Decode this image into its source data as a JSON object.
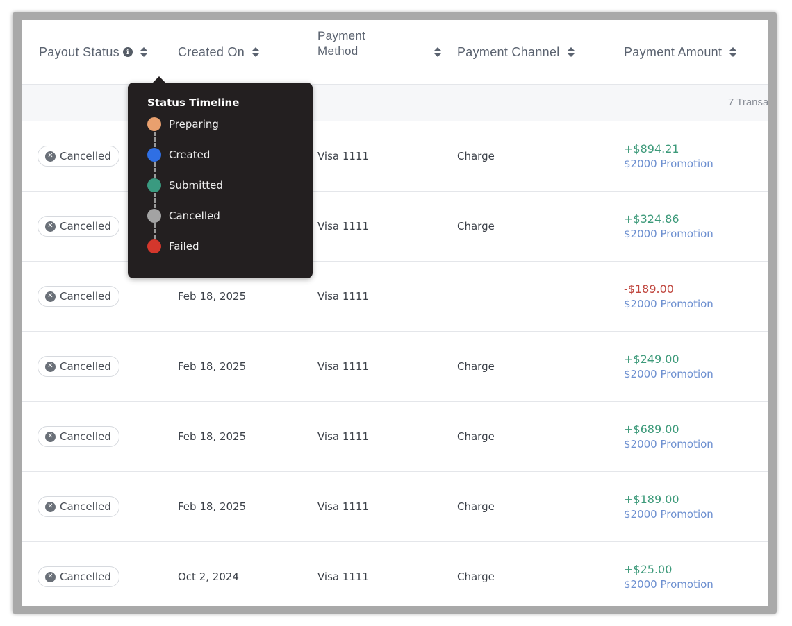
{
  "header": {
    "payout_status": "Payout Status",
    "created_on": "Created On",
    "payment_method_line1": "Payment",
    "payment_method_line2": "Method",
    "payment_channel": "Payment Channel",
    "payment_amount": "Payment Amount"
  },
  "group": {
    "count_text": "7 Transa"
  },
  "rows": [
    {
      "status": "Cancelled",
      "created": "",
      "method": "Visa 1111",
      "channel": "Charge",
      "amount": "+$894.21",
      "promo": "$2000 Promotion"
    },
    {
      "status": "Cancelled",
      "created": "",
      "method": "Visa 1111",
      "channel": "Charge",
      "amount": "+$324.86",
      "promo": "$2000 Promotion"
    },
    {
      "status": "Cancelled",
      "created": "Feb 18, 2025",
      "method": "Visa 1111",
      "channel": "",
      "amount": "-$189.00",
      "promo": "$2000 Promotion"
    },
    {
      "status": "Cancelled",
      "created": "Feb 18, 2025",
      "method": "Visa 1111",
      "channel": "Charge",
      "amount": "+$249.00",
      "promo": "$2000 Promotion"
    },
    {
      "status": "Cancelled",
      "created": "Feb 18, 2025",
      "method": "Visa 1111",
      "channel": "Charge",
      "amount": "+$689.00",
      "promo": "$2000 Promotion"
    },
    {
      "status": "Cancelled",
      "created": "Feb 18, 2025",
      "method": "Visa 1111",
      "channel": "Charge",
      "amount": "+$189.00",
      "promo": "$2000 Promotion"
    },
    {
      "status": "Cancelled",
      "created": "Oct 2, 2024",
      "method": "Visa 1111",
      "channel": "Charge",
      "amount": "+$25.00",
      "promo": "$2000 Promotion"
    }
  ],
  "tooltip": {
    "title": "Status Timeline",
    "items": [
      {
        "label": "Preparing",
        "color": "#e9a06e"
      },
      {
        "label": "Created",
        "color": "#2f6fe4"
      },
      {
        "label": "Submitted",
        "color": "#3a9a80"
      },
      {
        "label": "Cancelled",
        "color": "#a3a3a3"
      },
      {
        "label": "Failed",
        "color": "#d4372c"
      }
    ]
  },
  "colors": {
    "positive": "#3d9a7a",
    "negative": "#c0473f",
    "promo": "#6c8fd0"
  },
  "icons": {
    "info": "info-icon",
    "sort": "sort-icon",
    "cancel": "x-circle-icon"
  }
}
